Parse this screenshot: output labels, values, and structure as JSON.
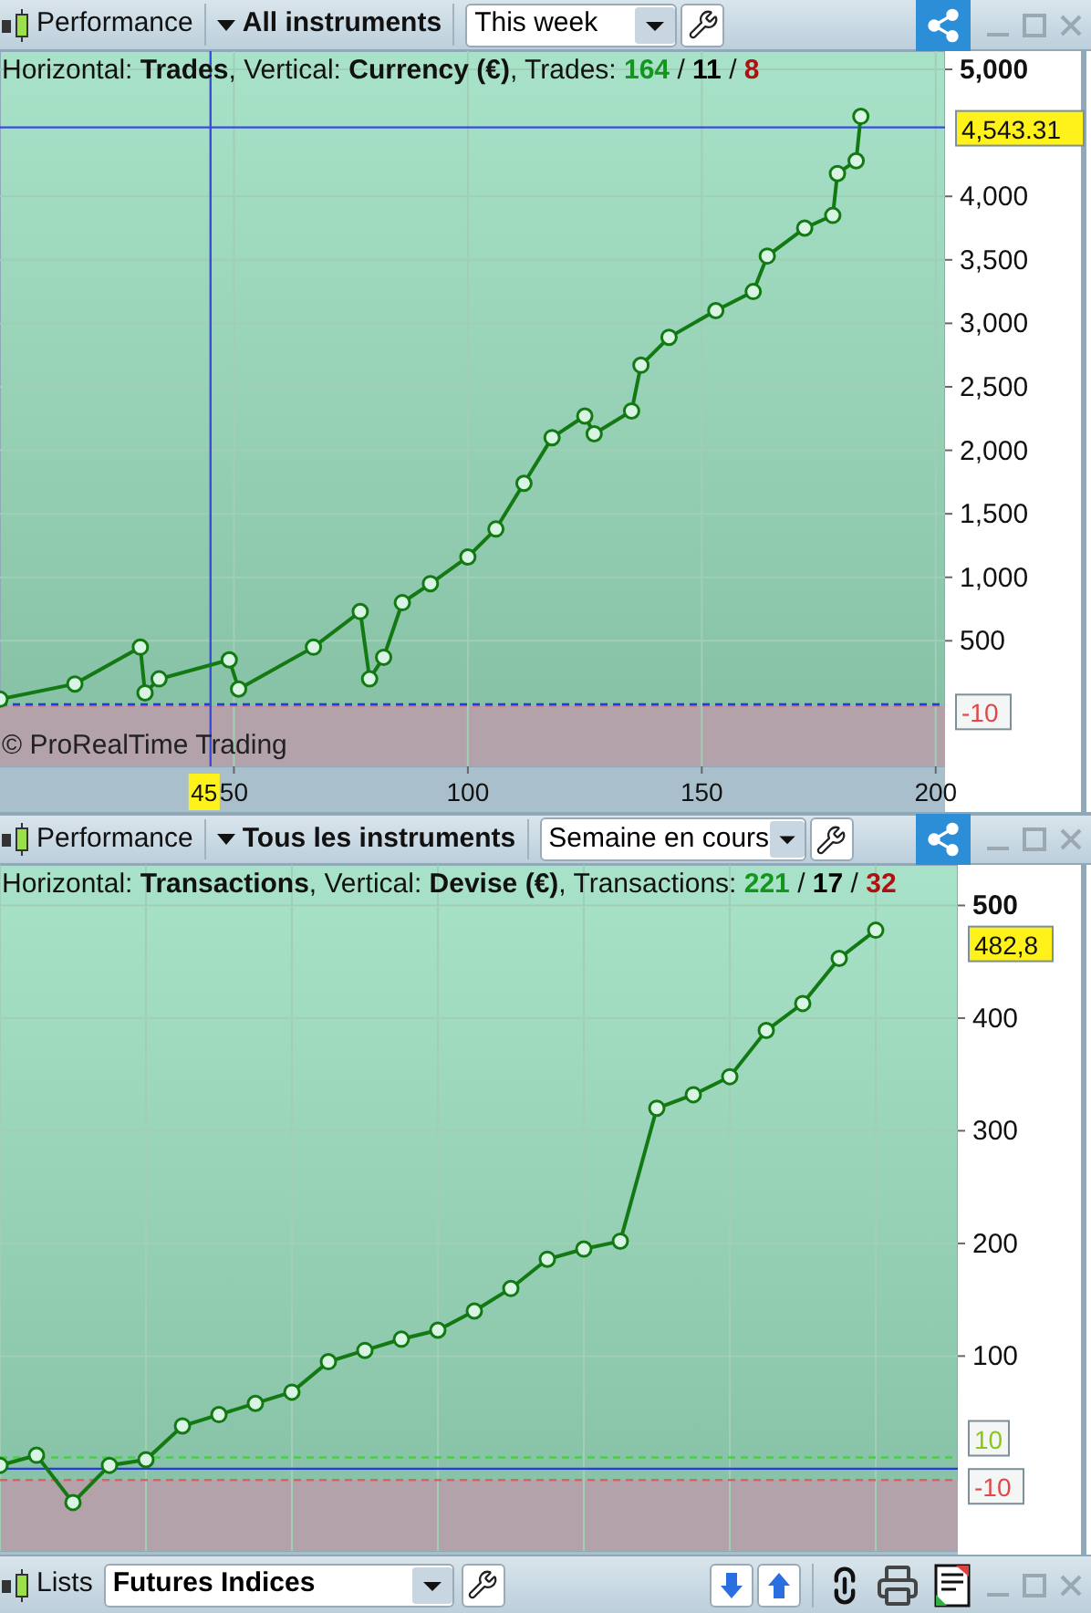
{
  "panels": [
    {
      "toolbar": {
        "title": "Performance",
        "scope": "All instruments",
        "period": "This week"
      },
      "header": {
        "text": "Horizontal: **Trades**, Vertical: **Currency (€)**, Trades:",
        "separator": "/",
        "counts": [
          {
            "value": "164",
            "color": "#14961e"
          },
          {
            "value": "11",
            "color": "#000000"
          },
          {
            "value": "8",
            "color": "#b01010"
          }
        ]
      },
      "copyright": "© ProRealTime Trading",
      "cursor": {
        "x_label": "45",
        "y_label": "4,543.31"
      },
      "threshold_labels": [
        {
          "text": "-10",
          "kind": "lower"
        }
      ],
      "chart_data": {
        "type": "line",
        "grid": true,
        "xlim": [
          0,
          202
        ],
        "ylim": [
          -489,
          5144
        ],
        "xticks": [
          50,
          100,
          150,
          200
        ],
        "yticks": [
          500,
          {
            "value": 1000,
            "label": "1,000"
          },
          {
            "value": 1500,
            "label": "1,500"
          },
          {
            "value": 2000,
            "label": "2,000"
          },
          {
            "value": 2500,
            "label": "2,500"
          },
          {
            "value": 3000,
            "label": "3,000"
          },
          {
            "value": 3500,
            "label": "3,500"
          },
          {
            "value": 4000,
            "label": "4,000"
          },
          {
            "value": 5000,
            "label": "5,000"
          }
        ],
        "ref_lines": [
          {
            "axis": "y",
            "value": -10,
            "color": "#e06060"
          },
          {
            "axis": "y",
            "value": 0,
            "color": "#2a3ad8"
          },
          {
            "axis": "x",
            "value": 45,
            "color": "#3a4ce0"
          },
          {
            "axis": "y",
            "value": 4543.31,
            "color": "#3a4ce0"
          }
        ],
        "x": [
          0,
          16,
          30,
          31,
          34,
          49,
          51,
          67,
          77,
          79,
          82,
          86,
          92,
          100,
          106,
          112,
          118,
          125,
          127,
          135,
          137,
          143,
          153,
          161,
          164,
          172,
          178,
          179,
          183,
          184
        ],
        "series": [
          {
            "color": "#137a13",
            "marker": "o",
            "values": [
              40,
              160,
              450,
              90,
              200,
              350,
              120,
              450,
              730,
              200,
              370,
              800,
              950,
              1160,
              1380,
              1740,
              2100,
              2270,
              2130,
              2310,
              2670,
              2890,
              3100,
              3250,
              3530,
              3750,
              3850,
              4180,
              4280,
              4630
            ]
          }
        ]
      }
    },
    {
      "toolbar": {
        "title": "Performance",
        "scope": "Tous les instruments",
        "period": "Semaine en cours"
      },
      "header": {
        "text": "Horizontal: **Transactions**, Vertical: **Devise (€)**, Transactions:",
        "separator": "/",
        "counts": [
          {
            "value": "221",
            "color": "#14961e"
          },
          {
            "value": "17",
            "color": "#000000"
          },
          {
            "value": "32",
            "color": "#b01010"
          }
        ]
      },
      "last_value": "482,8",
      "threshold_labels": [
        {
          "text": "10",
          "kind": "upper"
        },
        {
          "text": "-10",
          "kind": "lower"
        }
      ],
      "chart_data": {
        "type": "line",
        "grid": true,
        "ylim": [
          -73,
          536
        ],
        "yticks": [
          100,
          200,
          300,
          400,
          500
        ],
        "ref_lines": [
          {
            "axis": "y",
            "value": 10,
            "color": "#4ccc4c"
          },
          {
            "axis": "y",
            "value": 0,
            "color": "#2a3ad8"
          },
          {
            "axis": "y",
            "value": -10,
            "color": "#e06060"
          }
        ],
        "categories": [
          null,
          null,
          null,
          null,
          null,
          null,
          null,
          null,
          null,
          null,
          null,
          null,
          null,
          null,
          null,
          null,
          null,
          null,
          null,
          null,
          null,
          null,
          null,
          null,
          null
        ],
        "series": [
          {
            "color": "#137a13",
            "marker": "o",
            "values": [
              3,
              12,
              -30,
              3,
              8,
              38,
              48,
              58,
              68,
              95,
              105,
              115,
              123,
              140,
              160,
              186,
              195,
              202,
              320,
              332,
              348,
              389,
              413,
              453,
              478
            ]
          }
        ]
      }
    }
  ],
  "lists_bar": {
    "title": "Lists",
    "list": "Futures Indices"
  }
}
